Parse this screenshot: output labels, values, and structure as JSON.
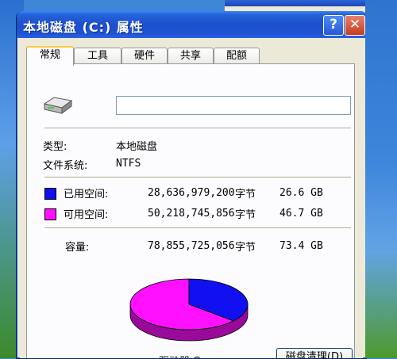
{
  "window": {
    "title": "本地磁盘 (C:) 属性",
    "help_label": "?",
    "close_label": "✕"
  },
  "tabs": [
    {
      "label": "常规",
      "active": true
    },
    {
      "label": "工具",
      "active": false
    },
    {
      "label": "硬件",
      "active": false
    },
    {
      "label": "共享",
      "active": false
    },
    {
      "label": "配额",
      "active": false
    }
  ],
  "general": {
    "volume_name_value": "",
    "type_label": "类型:",
    "type_value": "本地磁盘",
    "fs_label": "文件系统:",
    "fs_value": "NTFS",
    "used": {
      "label": "已用空间:",
      "bytes": "28,636,979,200",
      "unit": "字节",
      "size": "26.6 GB",
      "color": "#1010f0"
    },
    "free": {
      "label": "可用空间:",
      "bytes": "50,218,745,856",
      "unit": "字节",
      "size": "46.7 GB",
      "color": "#ff10ff"
    },
    "capacity": {
      "label": "容量:",
      "bytes": "78,855,725,056",
      "unit": "字节",
      "size": "73.4 GB"
    },
    "drive_label": "驱动器 C",
    "cleanup_button": "磁盘清理(D)",
    "used_fraction": 0.3632
  },
  "icons": {
    "drive": "hard-drive-icon",
    "help": "help-icon",
    "close": "close-icon"
  }
}
